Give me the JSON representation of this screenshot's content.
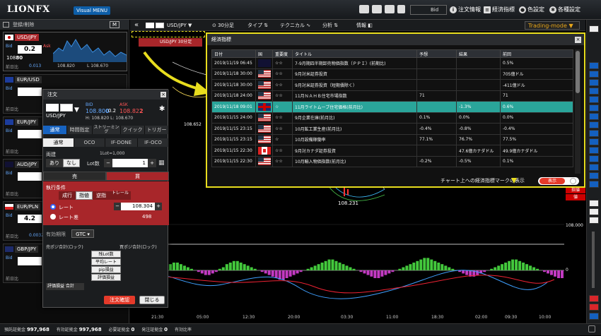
{
  "app": {
    "logo": "LIONFX",
    "visual_menu": "Visual MENU",
    "bid_select": "Bid",
    "menu": {
      "orders": "注文情報",
      "indicators": "経済指標",
      "color": "色設定",
      "settings": "各種設定"
    }
  },
  "left_panel": {
    "header": "登録/削除",
    "prev_label": "前日比",
    "cards": [
      {
        "pair": "USD/JPY",
        "flag": "jp",
        "bid_big": "0.2",
        "bid_pips": "80",
        "bid_main": "108",
        "ask_label": "Ask",
        "change": "0.013",
        "high": "108.820",
        "low": "L 108.670",
        "selected": true
      },
      {
        "pair": "EUR/USD",
        "flag": "eu",
        "bid_big": "",
        "bid_pips": "",
        "bid_main": "",
        "change": "",
        "selected": false
      },
      {
        "pair": "EUR/JPY",
        "flag": "eu",
        "bid_big": "",
        "bid_pips": "",
        "bid_main": "",
        "change": "",
        "selected": false
      },
      {
        "pair": "AUD/JPY",
        "flag": "au",
        "bid_big": "",
        "bid_pips": "",
        "bid_main": "",
        "change": "",
        "selected": false
      },
      {
        "pair": "EUR/PLN",
        "flag": "pl",
        "bid_big": "4.2",
        "bid_pips": "",
        "bid_main": "",
        "change": "0.0032",
        "selected": false
      },
      {
        "pair": "GBP/JPY",
        "flag": "gb",
        "bid_big": "",
        "bid_pips": "",
        "bid_main": "",
        "change": "",
        "selected": false
      }
    ]
  },
  "chart": {
    "symbol": "USD/JPY",
    "timeframe": "30分足",
    "type_btn": "タイプ",
    "technical_btn": "テクニカル",
    "analysis_btn": "分析",
    "info_btn": "情報",
    "trading_mode": "Trading-mode",
    "tooltip": "USD/JPY 30分足",
    "price_labels": [
      "108.000",
      "108.231"
    ],
    "pane_label": "0",
    "candle_labels": [
      "108.652",
      "108.231"
    ],
    "time_labels": [
      "21:30",
      "05:00",
      "12:30",
      "20:00",
      "03:30",
      "11:00",
      "18:30",
      "02:00",
      "09:30",
      "17:00",
      "00:30",
      "08:00",
      "10:00"
    ],
    "right_tags": [
      "値",
      "指値"
    ]
  },
  "order_panel": {
    "title": "注文",
    "pair": "USD/JPY",
    "bid_label": "BID",
    "ask_label": "ASK",
    "bid": "108.80",
    "bid_small": "0",
    "ask": "108.82",
    "ask_small": "2",
    "high_low": "H: 108.820  L: 108.670",
    "spread": "0.2",
    "tabs1": [
      "通常",
      "時間指定",
      "ストリーミング",
      "クイック",
      "トリガー"
    ],
    "tabs2": [
      "通常",
      "OCO",
      "IF-DONE",
      "IF-OCO"
    ],
    "ryodate": "両建",
    "ari": "あり",
    "nashi": "なし",
    "lot_label": "Lot数",
    "lot_unit": "1Lot=1,000",
    "lot_value": "1",
    "sell": "売",
    "buy": "買",
    "cond_label": "執行条件",
    "cond_types": [
      "成行",
      "指値",
      "逆指",
      "トレール"
    ],
    "rate_label": "レート",
    "rate_value": "108.304",
    "rate_diff_label": "レート差",
    "rate_diff_value": "498",
    "expiry_label": "有効期限",
    "expiry_value": "GTC",
    "sell_pos": "売ポジ合計(ロック)",
    "buy_pos": "買ポジ合計(ロック)",
    "rows": [
      "残Lot数",
      "平均レート",
      "pip損益",
      "評価損益"
    ],
    "total": "評価損益 合計",
    "confirm": "注文確認",
    "close": "閉じる"
  },
  "econ": {
    "title": "経済指標",
    "headers": [
      "日付",
      "国",
      "重要度",
      "タイトル",
      "予想",
      "結果",
      "前回"
    ],
    "rows": [
      {
        "date": "2019/11/19 06:45",
        "flag": "au",
        "imp": "☆☆",
        "title": "7-9月期四半期卸売物価指数（ＰＰＩ）(前期比)",
        "forecast": "",
        "result": "",
        "prev": "0.5%",
        "hl": false
      },
      {
        "date": "2019/11/18 30:00",
        "flag": "us",
        "imp": "☆☆",
        "title": "9月対米証券投資",
        "forecast": "",
        "result": "",
        "prev": "705億ドル",
        "hl": false
      },
      {
        "date": "2019/11/18 30:00",
        "flag": "us",
        "imp": "☆☆",
        "title": "9月対米証券投資（短期債除く）",
        "forecast": "",
        "result": "",
        "prev": "-411億ドル",
        "hl": false
      },
      {
        "date": "2019/11/18 24:00",
        "flag": "us",
        "imp": "☆☆",
        "title": "11月ＮＡＨＢ住宅市場指数",
        "forecast": "71",
        "result": "",
        "prev": "71",
        "hl": false
      },
      {
        "date": "2019/11/18 09:01",
        "flag": "gb",
        "imp": "☆",
        "title": "11月ライトムーブ住宅価格(前月比)",
        "forecast": "",
        "result": "-1.3%",
        "prev": "0.6%",
        "hl": true
      },
      {
        "date": "2019/11/15 24:00",
        "flag": "us",
        "imp": "☆☆",
        "title": "9月企業在庫(前月比)",
        "forecast": "0.1%",
        "result": "0.0%",
        "prev": "0.0%",
        "hl": false
      },
      {
        "date": "2019/11/15 23:15",
        "flag": "us",
        "imp": "☆☆",
        "title": "10月鉱工業生産(前月比)",
        "forecast": "-0.4%",
        "result": "-0.8%",
        "prev": "-0.4%",
        "hl": false
      },
      {
        "date": "2019/11/15 23:15",
        "flag": "us",
        "imp": "☆",
        "title": "10月設備稼働率",
        "forecast": "77.1%",
        "result": "76.7%",
        "prev": "77.5%",
        "hl": false
      },
      {
        "date": "2019/11/15 22:30",
        "flag": "ca",
        "imp": "☆☆",
        "title": "9月対カナダ証券投資",
        "forecast": "",
        "result": "47.6億カナダドル",
        "prev": "49.9億カナダドル",
        "hl": false
      },
      {
        "date": "2019/11/15 22:30",
        "flag": "us",
        "imp": "☆☆",
        "title": "10月輸入物価指数(前月比)",
        "forecast": "-0.2%",
        "result": "-0.5%",
        "prev": "0.1%",
        "hl": false
      }
    ],
    "footer_label": "チャート上への経済指標マークの表示",
    "footer_toggle": "表示"
  },
  "bottom": {
    "items": [
      {
        "label": "預託証拠金",
        "value": "997,968"
      },
      {
        "label": "有効証拠金",
        "value": "997,968"
      },
      {
        "label": "必要証拠金",
        "value": "0"
      },
      {
        "label": "発注証拠金",
        "value": "0"
      },
      {
        "label": "有効比率",
        "value": ""
      }
    ]
  },
  "chart_series": {
    "macd_hist": [
      -2,
      -3,
      -4,
      -4,
      -3,
      -2,
      -1,
      0,
      1,
      2,
      3,
      4,
      5,
      5,
      4,
      3,
      2,
      1,
      0,
      -1,
      -2,
      -3,
      -3,
      -2,
      -1,
      1,
      2,
      4,
      5,
      6,
      6,
      5,
      4,
      3,
      2,
      1,
      0,
      -1,
      -2,
      -3,
      -4,
      -5,
      -6,
      -6,
      -5,
      -4,
      -3,
      -2,
      -1,
      0,
      1,
      2,
      3,
      4,
      5,
      6,
      7,
      7,
      6,
      5,
      4,
      3,
      2,
      1,
      0,
      -1,
      -2,
      -3,
      -4,
      -5,
      -5,
      -4,
      -3,
      -2,
      -1,
      0,
      1,
      2,
      3,
      4,
      5,
      6,
      7,
      8,
      8,
      7,
      6,
      5,
      4,
      3,
      2,
      1,
      0,
      -1,
      -2,
      -3,
      -4,
      -4,
      -3,
      -2,
      -1,
      0,
      1,
      2,
      3,
      4,
      5,
      6,
      7,
      7,
      6,
      5,
      4,
      3,
      2,
      1,
      0,
      -1,
      -2,
      -3,
      -4,
      -5,
      -5
    ]
  }
}
